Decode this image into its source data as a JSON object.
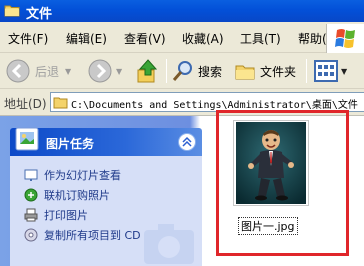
{
  "window": {
    "title": "文件"
  },
  "menu": [
    {
      "label": "文件(F)"
    },
    {
      "label": "编辑(E)"
    },
    {
      "label": "查看(V)"
    },
    {
      "label": "收藏(A)"
    },
    {
      "label": "工具(T)"
    },
    {
      "label": "帮助(H)"
    }
  ],
  "toolbar": {
    "back": "后退",
    "search": "搜索",
    "folders": "文件夹"
  },
  "address": {
    "label": "地址(D)",
    "path": "C:\\Documents and Settings\\Administrator\\桌面\\文件"
  },
  "tasks": {
    "title": "图片任务",
    "items": [
      {
        "label": "作为幻灯片查看"
      },
      {
        "label": "联机订购照片"
      },
      {
        "label": "打印图片"
      },
      {
        "label": "复制所有项目到 CD"
      }
    ]
  },
  "file": {
    "name": "图片一.jpg"
  },
  "colors": {
    "highlight": "#e0262a",
    "titlebar": "#0a5fe0",
    "task_header": "#0c49c8"
  }
}
